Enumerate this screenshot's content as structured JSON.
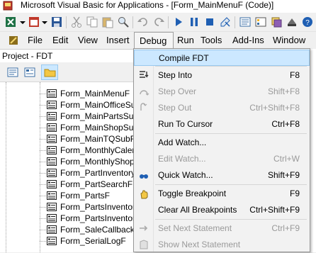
{
  "window": {
    "title": "Microsoft Visual Basic for Applications - [Form_MainMenuF (Code)]"
  },
  "toolbar": {
    "icons": [
      "excel-icon",
      "insert-userform-icon",
      "save-icon",
      "cut-icon",
      "copy-icon",
      "paste-icon",
      "find-icon",
      "undo-icon",
      "redo-icon",
      "run-icon",
      "break-icon",
      "reset-icon",
      "design-mode-icon",
      "project-explorer-icon",
      "properties-icon",
      "object-browser-icon",
      "toolbox-icon"
    ]
  },
  "menubar": {
    "items": [
      "File",
      "Edit",
      "View",
      "Insert",
      "Debug",
      "Run",
      "Tools",
      "Add-Ins",
      "Window"
    ]
  },
  "project": {
    "title": "Project - FDT",
    "items": [
      "Form_MainMenuF",
      "Form_MainOfficeSubF",
      "Form_MainPartsSubF",
      "Form_MainShopSubF",
      "Form_MainTQSubF",
      "Form_MonthlyCalenda",
      "Form_MonthlyShopCa",
      "Form_PartInventoryO",
      "Form_PartSearchF",
      "Form_PartsF",
      "Form_PartsInventory",
      "Form_PartsInventory",
      "Form_SaleCallbackF",
      "Form_SerialLogF"
    ]
  },
  "debug_menu": {
    "items": [
      {
        "label": "Compile FDT",
        "shortcut": "",
        "icon": "",
        "disabled": false,
        "highlighted": true
      },
      {
        "label": "Step Into",
        "shortcut": "F8",
        "icon": "step-into-icon",
        "disabled": false
      },
      {
        "label": "Step Over",
        "shortcut": "Shift+F8",
        "icon": "step-over-icon",
        "disabled": true
      },
      {
        "label": "Step Out",
        "shortcut": "Ctrl+Shift+F8",
        "icon": "step-out-icon",
        "disabled": true
      },
      {
        "label": "Run To Cursor",
        "shortcut": "Ctrl+F8",
        "icon": "",
        "disabled": false
      },
      {
        "label": "Add Watch...",
        "shortcut": "",
        "icon": "",
        "disabled": false
      },
      {
        "label": "Edit Watch...",
        "shortcut": "Ctrl+W",
        "icon": "",
        "disabled": true
      },
      {
        "label": "Quick Watch...",
        "shortcut": "Shift+F9",
        "icon": "quick-watch-icon",
        "disabled": false
      },
      {
        "label": "Toggle Breakpoint",
        "shortcut": "F9",
        "icon": "breakpoint-hand-icon",
        "disabled": false
      },
      {
        "label": "Clear All Breakpoints",
        "shortcut": "Ctrl+Shift+F9",
        "icon": "",
        "disabled": false
      },
      {
        "label": "Set Next Statement",
        "shortcut": "Ctrl+F9",
        "icon": "set-next-statement-icon",
        "disabled": true
      },
      {
        "label": "Show Next Statement",
        "shortcut": "",
        "icon": "show-next-statement-icon",
        "disabled": true
      }
    ]
  }
}
